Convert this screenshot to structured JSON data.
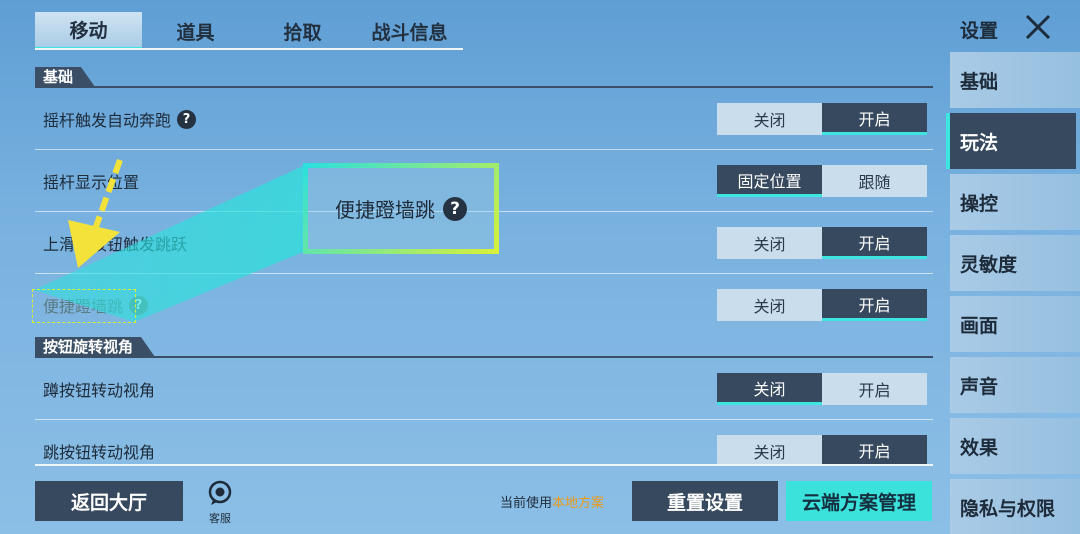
{
  "tabs": [
    {
      "label": "移动",
      "active": true
    },
    {
      "label": "道具",
      "active": false
    },
    {
      "label": "拾取",
      "active": false
    },
    {
      "label": "战斗信息",
      "active": false
    }
  ],
  "sections": {
    "basic": "基础",
    "rotate": "按钮旋转视角"
  },
  "rows": [
    {
      "label": "摇杆触发自动奔跑",
      "help": true,
      "options": [
        "关闭",
        "开启"
      ],
      "selected": 1
    },
    {
      "label": "摇杆显示位置",
      "help": false,
      "options": [
        "固定位置",
        "跟随"
      ],
      "selected": 0
    },
    {
      "label": "上滑蹲按钮触发跳跃",
      "help": false,
      "options": [
        "关闭",
        "开启"
      ],
      "selected": 1
    },
    {
      "label": "便捷蹬墙跳",
      "help": true,
      "options": [
        "关闭",
        "开启"
      ],
      "selected": 1
    },
    {
      "label": "蹲按钮转动视角",
      "help": false,
      "options": [
        "关闭",
        "开启"
      ],
      "selected": 0
    },
    {
      "label": "跳按钮转动视角",
      "help": false,
      "options": [
        "关闭",
        "开启"
      ],
      "selected": 1
    }
  ],
  "sidebar": {
    "title": "设置",
    "items": [
      {
        "label": "基础",
        "active": false
      },
      {
        "label": "玩法",
        "active": true
      },
      {
        "label": "操控",
        "active": false
      },
      {
        "label": "灵敏度",
        "active": false
      },
      {
        "label": "画面",
        "active": false
      },
      {
        "label": "声音",
        "active": false
      },
      {
        "label": "效果",
        "active": false
      },
      {
        "label": "隐私与权限",
        "active": false
      }
    ]
  },
  "bottom": {
    "back_label": "返回大厅",
    "cs_label": "客服",
    "current_prefix": "当前使用",
    "current_scheme": "本地方案",
    "reset_label": "重置设置",
    "cloud_label": "云端方案管理"
  },
  "callout": {
    "text": "便捷蹬墙跳"
  },
  "icons": {
    "help": "question-circle-icon",
    "close": "close-x-icon",
    "cs": "customer-service-icon",
    "arrow": "pointer-arrow-icon"
  },
  "colors": {
    "accent": "#3ee4e0",
    "dark": "#36495e",
    "highlight": "#d7f03a",
    "scheme": "#e89a1d"
  }
}
